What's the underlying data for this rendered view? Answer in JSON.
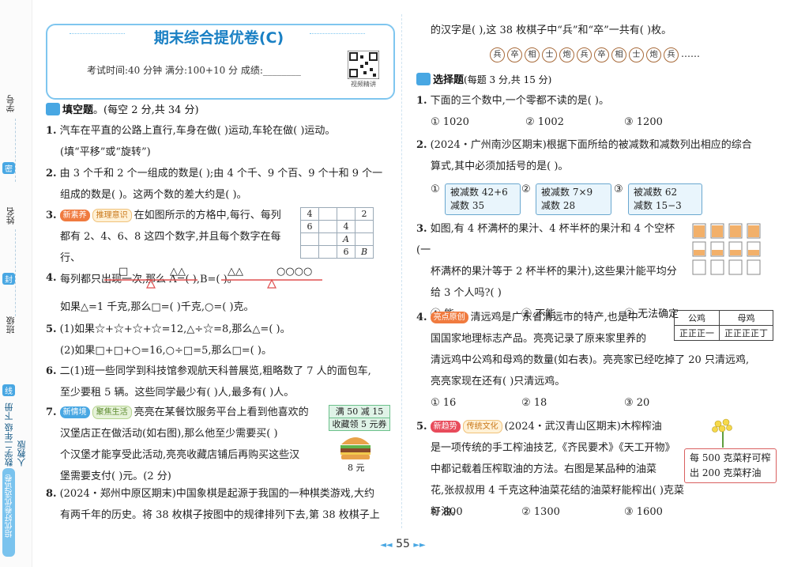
{
  "sidebar": {
    "student_id": "学号",
    "name": "姓名",
    "class": "班级",
    "seal": "密",
    "seal2": "封",
    "seal3": "线",
    "book": "数学二年级 下册 人教版",
    "brand": "培优好卷优选试卷"
  },
  "header": {
    "title": "期末综合提优卷(C)",
    "exam_info": "考试时间:40 分钟   满分:100+10 分   成绩:________",
    "qr_caption": "视频精讲"
  },
  "section1": {
    "title": "填空题",
    "points": "。(每空 2 分,共 34 分)"
  },
  "q1": {
    "num": "1.",
    "text1": "汽车在平直的公路上直行,车身在做(   )运动,车轮在做(   )运动。",
    "text2": "(填“平移”或“旋转”)"
  },
  "q2": {
    "num": "2.",
    "text1": "由 3 个千和 2 个一组成的数是(   );由 4 个千、9 个百、9 个十和 9 个一",
    "text2": "组成的数是(   )。这两个数的差大约是(   )。"
  },
  "q3": {
    "num": "3.",
    "tag1": "新素养",
    "tag2": "推理意识",
    "text1": "在如图所示的方格中,每行、每列",
    "text2": "都有 2、4、6、8 这四个数字,并且每个数字在每行、",
    "text3": "每列都只出现一次,那么 A=(   ),B=(   )。",
    "grid": [
      [
        "4",
        "",
        "",
        "2"
      ],
      [
        "6",
        "",
        "4",
        ""
      ],
      [
        "",
        "",
        "A",
        ""
      ],
      [
        "",
        "",
        "6",
        "B"
      ]
    ]
  },
  "q4": {
    "num": "4.",
    "balance": [
      "□",
      "△△",
      "△△",
      "○○○○"
    ],
    "text": "如果△=1 千克,那么□=(   )千克,○=(   )克。"
  },
  "q5": {
    "num": "5.",
    "text1": "(1)如果☆+☆+☆+☆=12,△÷☆=8,那么△=(     )。",
    "text2": "(2)如果□+□+○=16,○÷□=5,那么□=(     )。"
  },
  "q6": {
    "num": "6.",
    "text1": "二(1)班一些同学到科技馆参观航天科普展览,粗略数了 7 人的面包车,",
    "text2": "至少要租 5 辆。这些同学最少有(   )人,最多有(   )人。"
  },
  "q7": {
    "num": "7.",
    "tag1": "新情境",
    "tag2": "聚焦生活",
    "text1": "亮亮在某餐饮服务平台上看到他喜欢的",
    "text2": "汉堡店正在做活动(如右图),那么他至少需要买(   )",
    "text3": "个汉堡才能享受此活动,亮亮收藏店铺后再购买这些汉",
    "text4": "堡需要支付(   )元。(2 分)",
    "coupon1": "满 50 减 15",
    "coupon2": "收藏领 5 元券",
    "price": "8 元"
  },
  "q8": {
    "num": "8.",
    "text1": "(2024・郑州中原区期末)中国象棋是起源于我国的一种棋类游戏,大约",
    "text2": "有两千年的历史。将 38 枚棋子按图中的规律排列下去,第 38 枚棋子上",
    "text3": "的汉字是(   ),这 38 枚棋子中“兵”和“卒”一共有(   )枚。",
    "pieces": [
      "兵",
      "卒",
      "相",
      "士",
      "炮",
      "兵",
      "卒",
      "相",
      "士",
      "炮",
      "兵"
    ],
    "ellipsis": "……"
  },
  "section2": {
    "title": "选择题",
    "points": "(每题 3 分,共 15 分)"
  },
  "c1": {
    "num": "1.",
    "text": "下面的三个数中,一个零都不读的是(   )。",
    "options": [
      "① 1020",
      "② 1002",
      "③ 1200"
    ]
  },
  "c2": {
    "num": "2.",
    "text1": "(2024・广州南沙区期末)根据下面所给的被减数和减数列出相应的综合",
    "text2": "算式,其中必须加括号的是(   )。",
    "opts": [
      {
        "mark": "①",
        "r1": "被减数   42+6",
        "r2": "减数     35"
      },
      {
        "mark": "②",
        "r1": "被减数   7×9",
        "r2": "减数     28"
      },
      {
        "mark": "③",
        "r1": "被减数    62",
        "r2": "减数   15−3"
      }
    ]
  },
  "c3": {
    "num": "3.",
    "text1": "如图,有 4 杯满杯的果汁、4 杯半杯的果汁和 4 个空杯(一",
    "text2": "杯满杯的果汁等于 2 杯半杯的果汁),这些果汁能平均分",
    "text3": "给 3 个人吗?(   )",
    "options": [
      "① 能",
      "② 不能",
      "③ 无法确定"
    ]
  },
  "c4": {
    "num": "4.",
    "tag": "亮点原创",
    "text1": "清远鸡是广东省清远市的特产,也是中",
    "text2": "国国家地理标志产品。亮亮记录了原来家里养的",
    "text3": "清远鸡中公鸡和母鸡的数量(如右表)。亮亮家已经吃掉了 20 只清远鸡,",
    "text4": "亮亮家现在还有(   )只清远鸡。",
    "table_head": [
      "公鸡",
      "母鸡"
    ],
    "table_row": [
      "正正正一",
      "正正正正丁"
    ],
    "options": [
      "① 16",
      "② 18",
      "③ 20"
    ]
  },
  "c5": {
    "num": "5.",
    "tag1": "新趋势",
    "tag2": "传统文化",
    "text1": "(2024・武汉青山区期末)木榨榨油",
    "text2": "是一项传统的手工榨油技艺,《齐民要术》《天工开物》",
    "text3": "中都记载着压榨取油的方法。右图是某品种的油菜",
    "text4": "花,张叔叔用 4 千克这种油菜花结的油菜籽能榨出(   )克菜籽油。",
    "sign1": "每 500 克菜籽可榨",
    "sign2": "出 200 克菜籽油",
    "options": [
      "① 800",
      "② 1300",
      "③ 1600"
    ]
  },
  "footer": {
    "page": "55"
  }
}
